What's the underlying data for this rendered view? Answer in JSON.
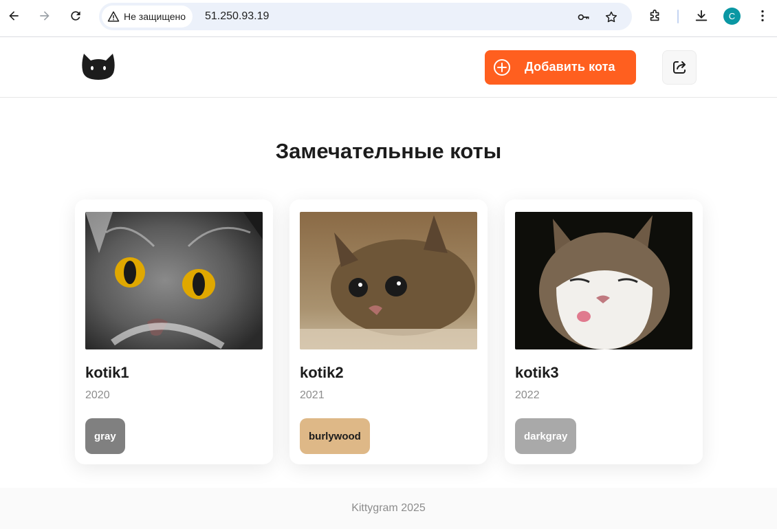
{
  "browser": {
    "security_label": "Не защищено",
    "url": "51.250.93.19",
    "profile_initial": "C"
  },
  "header": {
    "add_button_label": "Добавить кота",
    "accent_color": "#ff5f1f"
  },
  "main": {
    "title": "Замечательные коты",
    "cards": [
      {
        "name": "kotik1",
        "year": "2020",
        "color_label": "gray",
        "color_hex": "#808080",
        "chip_text_color": "#ffffff"
      },
      {
        "name": "kotik2",
        "year": "2021",
        "color_label": "burlywood",
        "color_hex": "#deb887",
        "chip_text_color": "#1c1c1c"
      },
      {
        "name": "kotik3",
        "year": "2022",
        "color_label": "darkgray",
        "color_hex": "#a9a9a9",
        "chip_text_color": "#ffffff"
      }
    ]
  },
  "footer": {
    "text": "Kittygram 2025"
  }
}
